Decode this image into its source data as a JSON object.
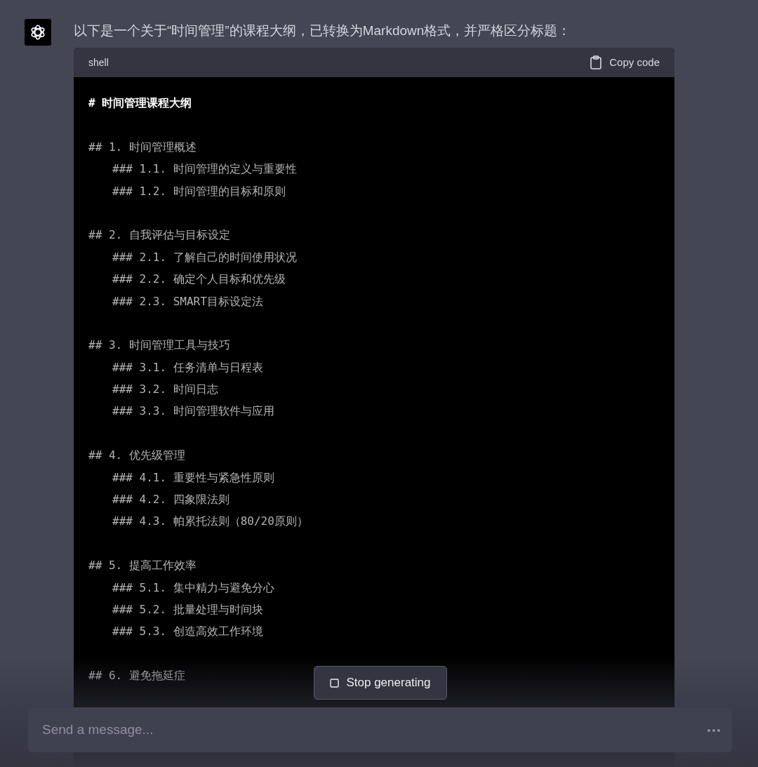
{
  "message": {
    "text": "以下是一个关于“时间管理”的课程大纲，已转换为Markdown格式，并严格区分标题："
  },
  "code_block": {
    "language": "shell",
    "copy_label": "Copy code",
    "title": "# 时间管理课程大纲",
    "sections": [
      {
        "heading": "## 1. 时间管理概述",
        "subsections": [
          "### 1.1. 时间管理的定义与重要性",
          "### 1.2. 时间管理的目标和原则"
        ]
      },
      {
        "heading": "## 2. 自我评估与目标设定",
        "subsections": [
          "### 2.1. 了解自己的时间使用状况",
          "### 2.2. 确定个人目标和优先级",
          "### 2.3. SMART目标设定法"
        ]
      },
      {
        "heading": "## 3. 时间管理工具与技巧",
        "subsections": [
          "### 3.1. 任务清单与日程表",
          "### 3.2. 时间日志",
          "### 3.3. 时间管理软件与应用"
        ]
      },
      {
        "heading": "## 4. 优先级管理",
        "subsections": [
          "### 4.1. 重要性与紧急性原则",
          "### 4.2. 四象限法则",
          "### 4.3. 帕累托法则（80/20原则）"
        ]
      },
      {
        "heading": "## 5. 提高工作效率",
        "subsections": [
          "### 5.1. 集中精力与避免分心",
          "### 5.2. 批量处理与时间块",
          "### 5.3. 创造高效工作环境"
        ]
      },
      {
        "heading": "## 6. 避免拖延症"
      }
    ]
  },
  "stop_button": {
    "label": "Stop generating"
  },
  "composer": {
    "placeholder": "Send a message..."
  }
}
